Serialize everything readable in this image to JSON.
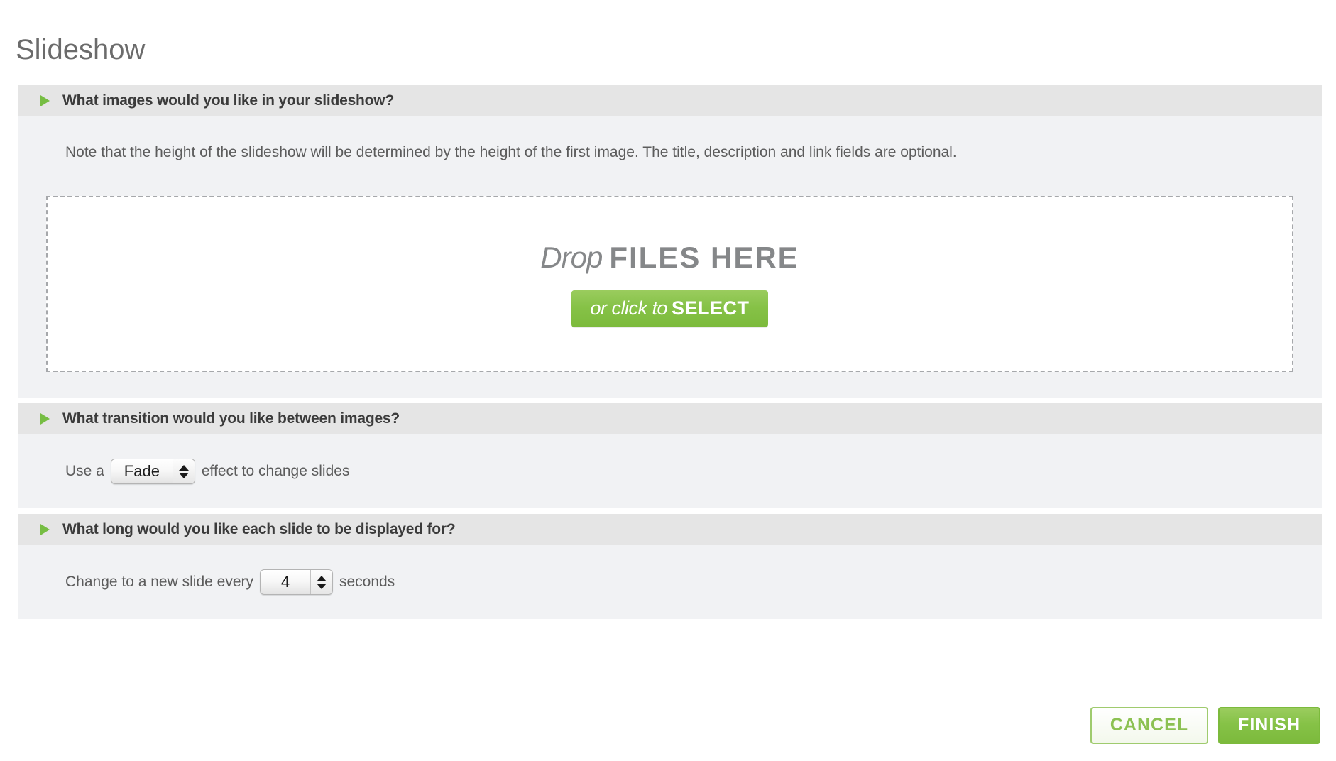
{
  "page": {
    "title": "Slideshow"
  },
  "sections": [
    {
      "id": "images",
      "header": "What images would you like in your slideshow?",
      "note": "Note that the height of the slideshow will be determined by the height of the first image. The title, description and link fields are optional.",
      "dropzone": {
        "drop_word": "Drop",
        "files_here": "FILES HERE",
        "button_italic": "or click to",
        "button_bold": "SELECT"
      }
    },
    {
      "id": "transition",
      "header": "What transition would you like between images?",
      "label_before": "Use a",
      "label_after": "effect to change slides",
      "select_value": "Fade",
      "select_options": [
        "Fade"
      ]
    },
    {
      "id": "duration",
      "header": "What long would you like each slide to be displayed for?",
      "label_before": "Change to a new slide every",
      "label_after": "seconds",
      "select_value": "4",
      "select_options": [
        "4"
      ]
    }
  ],
  "footer": {
    "cancel_label": "CANCEL",
    "finish_label": "FINISH"
  },
  "colors": {
    "accent_green": "#7cba3c",
    "triangle_green": "#76bd43",
    "header_bar": "#e5e5e5",
    "body_bg": "#f1f2f4",
    "title_text": "#6b6b6b",
    "body_text": "#5c5c5c",
    "dropzone_text": "#858789"
  },
  "icons": {
    "section_toggle": "triangle-right-icon",
    "stepper_up": "arrow-up-icon",
    "stepper_down": "arrow-down-icon"
  }
}
